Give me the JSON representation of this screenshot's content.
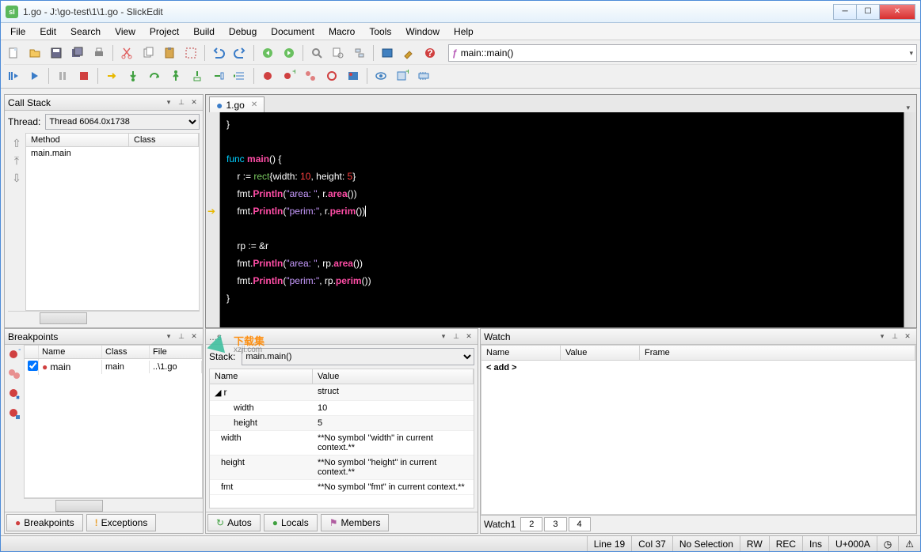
{
  "window": {
    "title": "1.go - J:\\go-test\\1\\1.go - SlickEdit"
  },
  "menu": [
    "File",
    "Edit",
    "Search",
    "View",
    "Project",
    "Build",
    "Debug",
    "Document",
    "Macro",
    "Tools",
    "Window",
    "Help"
  ],
  "symbol_combo": "main::main()",
  "editor": {
    "tab": "1.go"
  },
  "callstack": {
    "title": "Call Stack",
    "thread_label": "Thread:",
    "thread_value": "Thread 6064.0x1738",
    "headers": {
      "method": "Method",
      "class": "Class"
    },
    "row": {
      "method": "main.main",
      "class": ""
    }
  },
  "breakpoints": {
    "title": "Breakpoints",
    "headers": {
      "name": "Name",
      "class": "Class",
      "file": "File"
    },
    "row": {
      "name": "main",
      "class": "main",
      "file": "..\\1.go"
    },
    "tabs": {
      "breakpoints": "Breakpoints",
      "exceptions": "Exceptions"
    }
  },
  "autos": {
    "stack_label": "Stack:",
    "stack_value": "main.main()",
    "headers": {
      "name": "Name",
      "value": "Value"
    },
    "rows": [
      {
        "name": "r",
        "value": "struct"
      },
      {
        "name": "width",
        "value": "10"
      },
      {
        "name": "height",
        "value": "5"
      },
      {
        "name": "width",
        "value": "**No symbol \"width\" in current context.**"
      },
      {
        "name": "height",
        "value": "**No symbol \"height\" in current context.**"
      },
      {
        "name": "fmt",
        "value": "**No symbol \"fmt\" in current context.**"
      }
    ],
    "tabs": {
      "autos": "Autos",
      "locals": "Locals",
      "members": "Members"
    }
  },
  "watch": {
    "title": "Watch",
    "headers": {
      "name": "Name",
      "value": "Value",
      "frame": "Frame"
    },
    "add": "< add >",
    "tabs_label": "Watch1",
    "tabs": [
      "2",
      "3",
      "4"
    ]
  },
  "status": {
    "line": "Line 19",
    "col": "Col 37",
    "noselect": "No Selection",
    "rw": "RW",
    "rec": "REC",
    "ins": "Ins",
    "unicode": "U+000A"
  },
  "code_lines": [
    {
      "t": "plain",
      "text": "}"
    },
    {
      "t": "blank"
    },
    {
      "t": "func_main"
    },
    {
      "t": "rect_decl"
    },
    {
      "t": "print_area_r"
    },
    {
      "t": "print_perim_r",
      "arrow": true
    },
    {
      "t": "blank"
    },
    {
      "t": "rp_decl"
    },
    {
      "t": "print_area_rp"
    },
    {
      "t": "print_perim_rp"
    },
    {
      "t": "plain",
      "text": "}"
    }
  ],
  "watermark": {
    "text": "下载集",
    "sub": "xzji.com"
  }
}
